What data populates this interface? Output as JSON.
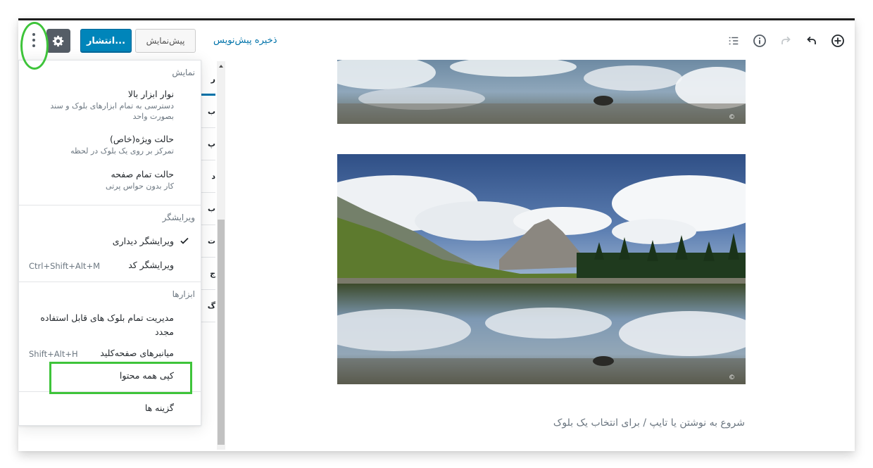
{
  "toolbar": {
    "publish_label": "انتشار...",
    "preview_label": "پیش‌نمایش",
    "save_draft_label": "ذخیره پیش‌نویس",
    "icons": [
      "more-vertical-icon",
      "gear-icon",
      "add-block-icon",
      "undo-icon",
      "redo-icon",
      "info-icon",
      "list-view-icon"
    ]
  },
  "menu": {
    "view": {
      "label": "نمایش",
      "items": [
        {
          "title": "نوار ابزار بالا",
          "help": "دسترسی به تمام ابزارهای بلوک و سند بصورت واحد"
        },
        {
          "title": "حالت ویژه(خاص)",
          "help": "تمرکز بر روی یک بلوک در لحظه"
        },
        {
          "title": "حالت تمام صفحه",
          "help": "کار بدون حواس پرتی"
        }
      ]
    },
    "editor": {
      "label": "ویرایشگر",
      "items": [
        {
          "title": "ویرایشگر دیداری",
          "checked": true,
          "shortcut": ""
        },
        {
          "title": "ویرایشگر کد",
          "checked": false,
          "shortcut": "Ctrl+Shift+Alt+M"
        }
      ]
    },
    "tools": {
      "label": "ابزارها",
      "items": [
        {
          "title": "مدیریت تمام بلوک های قابل استفاده مجدد",
          "shortcut": ""
        },
        {
          "title": "میانبرهای صفحه‌کلید",
          "shortcut": "Shift+Alt+H"
        },
        {
          "title": "کپی همه محتوا",
          "shortcut": ""
        }
      ]
    },
    "options_label": "گزینه ها"
  },
  "editor": {
    "placeholder": "شروع به نوشتن یا تایپ / برای انتخاب یک بلوک"
  },
  "sidebar_fragments": [
    "ر",
    "ب",
    "پ",
    "د",
    "ب",
    "ت",
    "ج",
    "گ"
  ],
  "colors": {
    "accent": "#0085ba",
    "highlight": "#3ec43a",
    "link": "#0073aa"
  }
}
